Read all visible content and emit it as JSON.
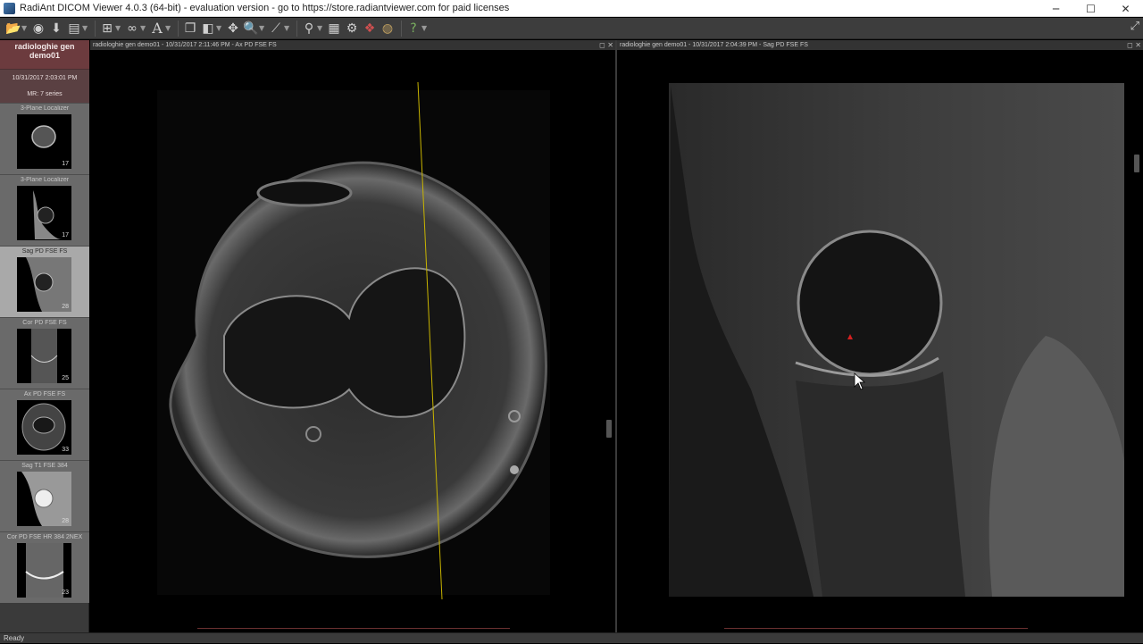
{
  "window": {
    "title": "RadiAnt DICOM Viewer 4.0.3 (64-bit) - evaluation version - go to https://store.radiantviewer.com for paid licenses",
    "minimize": "─",
    "maximize": "☐",
    "close": "✕"
  },
  "toolbar": {
    "icons": [
      "open-folder-icon",
      "cd-icon",
      "download-icon",
      "save-icon",
      "layout-grid-icon",
      "link-icon",
      "text-annotation-icon",
      "series-stack-icon",
      "window-level-icon",
      "pan-icon",
      "zoom-icon",
      "measure-line-icon",
      "3d-cursor-icon",
      "film-icon",
      "reset-icon",
      "mpr-icon",
      "3d-volume-icon",
      "help-icon"
    ]
  },
  "sidebar": {
    "patient_name": "radiologhie gen demo01",
    "study_date": "10/31/2017 2:03:01 PM",
    "study_info": "MR: 7 series",
    "series": [
      {
        "label": "3-Plane Localizer",
        "count": "17",
        "kind": "axial-small"
      },
      {
        "label": "3-Plane Localizer",
        "count": "17",
        "kind": "sagittal"
      },
      {
        "label": "Sag PD FSE FS",
        "count": "28",
        "kind": "sagittal-bright",
        "active": true
      },
      {
        "label": "Cor PD FSE FS",
        "count": "25",
        "kind": "coronal"
      },
      {
        "label": "Ax PD FSE FS",
        "count": "33",
        "kind": "axial"
      },
      {
        "label": "Sag T1 FSE 384",
        "count": "28",
        "kind": "sagittal-t1"
      },
      {
        "label": "Cor PD FSE HR 384 2NEX",
        "count": "23",
        "kind": "coronal-hr"
      }
    ]
  },
  "viewports": {
    "left": {
      "header": "radiologhie gen demo01 - 10/31/2017 2:11:46 PM - Ax PD FSE FS"
    },
    "right": {
      "header": "radiologhie gen demo01 - 10/31/2017 2:04:39 PM - Sag PD FSE FS"
    },
    "header_buttons": "◻ ✕"
  },
  "status": {
    "text": "Ready"
  },
  "colors": {
    "patient_bg": "#6c3b3e",
    "reference_line": "#c8b400",
    "marker": "#d42020"
  }
}
